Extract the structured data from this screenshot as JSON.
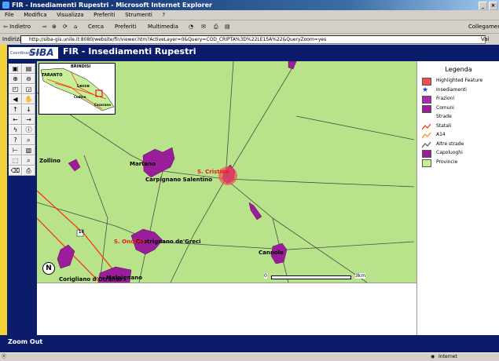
{
  "window": {
    "title": "FIR - Insediamenti Rupestri - Microsoft Internet Explorer",
    "controls": [
      "_",
      "×"
    ]
  },
  "menu": [
    "File",
    "Modifica",
    "Visualizza",
    "Preferiti",
    "Strumenti",
    "?"
  ],
  "toolbar": {
    "back": "⇦ Indietro",
    "search": "Cerca",
    "favorites": "Preferiti",
    "multimedia": "Multimedia",
    "links": "Collegamenti"
  },
  "address": {
    "label": "Indirizzo",
    "url": "http://siba-gis.unile.it:8080/website/fir/viewer.htm?ActiveLayer=0&Query=COD_CRIPTA%3D%22LE15A%22&QueryZoom=yes",
    "go": "Vai"
  },
  "app": {
    "logo_small": "Coordinamento",
    "logo": "SIBA",
    "title": "FIR - Insediamenti Rupestri"
  },
  "map": {
    "overview_labels": [
      "BRINDISI",
      "TARANTO",
      "Lecce",
      "Codine",
      "Casarano"
    ],
    "towns": [
      "Martano",
      "Carpignano Salentino",
      "Castrignano de'Greci",
      "Cannole",
      "Melpignano",
      "Corigliano d'Otranto",
      "Zollino"
    ],
    "highlighted_sites": [
      "S. Cristina",
      "S. Onofrio"
    ],
    "scale": {
      "start": "0",
      "end": "3km"
    },
    "north": "N",
    "road_label": "16"
  },
  "legend": {
    "title": "Legenda",
    "items": [
      {
        "label": "Highlighted Feature",
        "color": "#f05050",
        "type": "box"
      },
      {
        "label": "Insediamenti",
        "color": "#1f3fd6",
        "type": "star"
      },
      {
        "label": "Frazioni",
        "color": "#b028b0",
        "type": "box"
      },
      {
        "label": "Comuni",
        "color": "#9a1e9a",
        "type": "box"
      },
      {
        "label": "Strade",
        "color": "",
        "type": "none"
      },
      {
        "label": "Statali",
        "color": "#ff2a00",
        "type": "line"
      },
      {
        "label": "A14",
        "color": "#ff8c00",
        "type": "line"
      },
      {
        "label": "Altre strade",
        "color": "#555555",
        "type": "line"
      },
      {
        "label": "Capoluoghi",
        "color": "#9a1e9a",
        "type": "box"
      },
      {
        "label": "Provincie",
        "color": "#c8f09a",
        "type": "box"
      }
    ]
  },
  "footer": {
    "zoom_status": "Zoom Out"
  },
  "status": {
    "zone": "Internet"
  },
  "colors": {
    "header": "#0b1c6b",
    "map_bg": "#b9e38a",
    "town_fill": "#9a1e9a",
    "highlight": "#f05050"
  }
}
